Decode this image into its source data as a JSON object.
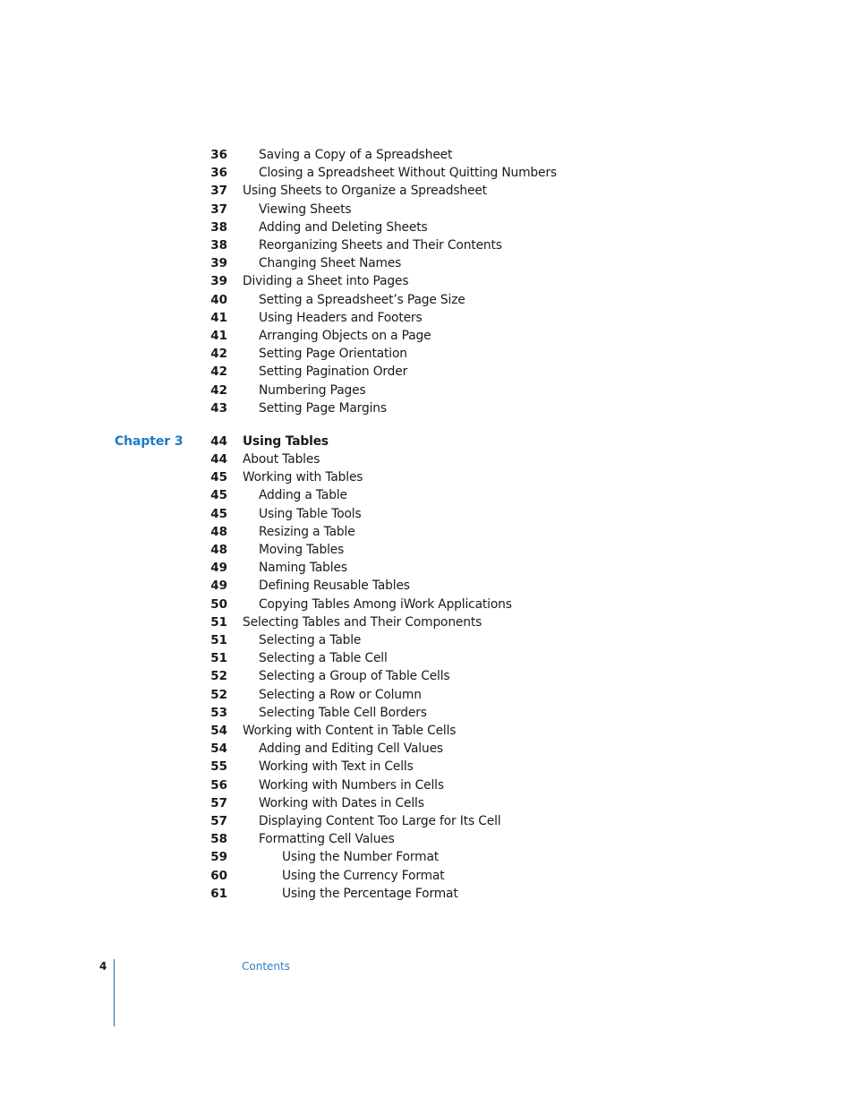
{
  "toc": {
    "continued": [
      {
        "page": "36",
        "title": "Saving a Copy of a Spreadsheet",
        "level": 2
      },
      {
        "page": "36",
        "title": "Closing a Spreadsheet Without Quitting Numbers",
        "level": 2
      },
      {
        "page": "37",
        "title": "Using Sheets to Organize a Spreadsheet",
        "level": 1
      },
      {
        "page": "37",
        "title": "Viewing Sheets",
        "level": 2
      },
      {
        "page": "38",
        "title": "Adding and Deleting Sheets",
        "level": 2
      },
      {
        "page": "38",
        "title": "Reorganizing Sheets and Their Contents",
        "level": 2
      },
      {
        "page": "39",
        "title": "Changing Sheet Names",
        "level": 2
      },
      {
        "page": "39",
        "title": "Dividing a Sheet into Pages",
        "level": 1
      },
      {
        "page": "40",
        "title": "Setting a Spreadsheet’s Page Size",
        "level": 2
      },
      {
        "page": "41",
        "title": "Using Headers and Footers",
        "level": 2
      },
      {
        "page": "41",
        "title": "Arranging Objects on a Page",
        "level": 2
      },
      {
        "page": "42",
        "title": "Setting Page Orientation",
        "level": 2
      },
      {
        "page": "42",
        "title": "Setting Pagination Order",
        "level": 2
      },
      {
        "page": "42",
        "title": "Numbering Pages",
        "level": 2
      },
      {
        "page": "43",
        "title": "Setting Page Margins",
        "level": 2
      }
    ],
    "chapter": {
      "label": "Chapter 3",
      "page": "44",
      "title": "Using Tables",
      "entries": [
        {
          "page": "44",
          "title": "About Tables",
          "level": 1
        },
        {
          "page": "45",
          "title": "Working with Tables",
          "level": 1
        },
        {
          "page": "45",
          "title": "Adding a Table",
          "level": 2
        },
        {
          "page": "45",
          "title": "Using Table Tools",
          "level": 2
        },
        {
          "page": "48",
          "title": "Resizing a Table",
          "level": 2
        },
        {
          "page": "48",
          "title": "Moving Tables",
          "level": 2
        },
        {
          "page": "49",
          "title": "Naming Tables",
          "level": 2
        },
        {
          "page": "49",
          "title": "Defining Reusable Tables",
          "level": 2
        },
        {
          "page": "50",
          "title": "Copying Tables Among iWork Applications",
          "level": 2
        },
        {
          "page": "51",
          "title": "Selecting Tables and Their Components",
          "level": 1
        },
        {
          "page": "51",
          "title": "Selecting a Table",
          "level": 2
        },
        {
          "page": "51",
          "title": "Selecting a Table Cell",
          "level": 2
        },
        {
          "page": "52",
          "title": "Selecting a Group of Table Cells",
          "level": 2
        },
        {
          "page": "52",
          "title": "Selecting a Row or Column",
          "level": 2
        },
        {
          "page": "53",
          "title": "Selecting Table Cell Borders",
          "level": 2
        },
        {
          "page": "54",
          "title": "Working with Content in Table Cells",
          "level": 1
        },
        {
          "page": "54",
          "title": "Adding and Editing Cell Values",
          "level": 2
        },
        {
          "page": "55",
          "title": "Working with Text in Cells",
          "level": 2
        },
        {
          "page": "56",
          "title": "Working with Numbers in Cells",
          "level": 2
        },
        {
          "page": "57",
          "title": "Working with Dates in Cells",
          "level": 2
        },
        {
          "page": "57",
          "title": "Displaying Content Too Large for Its Cell",
          "level": 2
        },
        {
          "page": "58",
          "title": "Formatting Cell Values",
          "level": 2
        },
        {
          "page": "59",
          "title": "Using the Number Format",
          "level": 3
        },
        {
          "page": "60",
          "title": "Using the Currency Format",
          "level": 3
        },
        {
          "page": "61",
          "title": "Using the Percentage Format",
          "level": 3
        }
      ]
    }
  },
  "footer": {
    "page_number": "4",
    "section": "Contents"
  },
  "colors": {
    "accent": "#1a7bc4",
    "text": "#1a1a1a"
  }
}
